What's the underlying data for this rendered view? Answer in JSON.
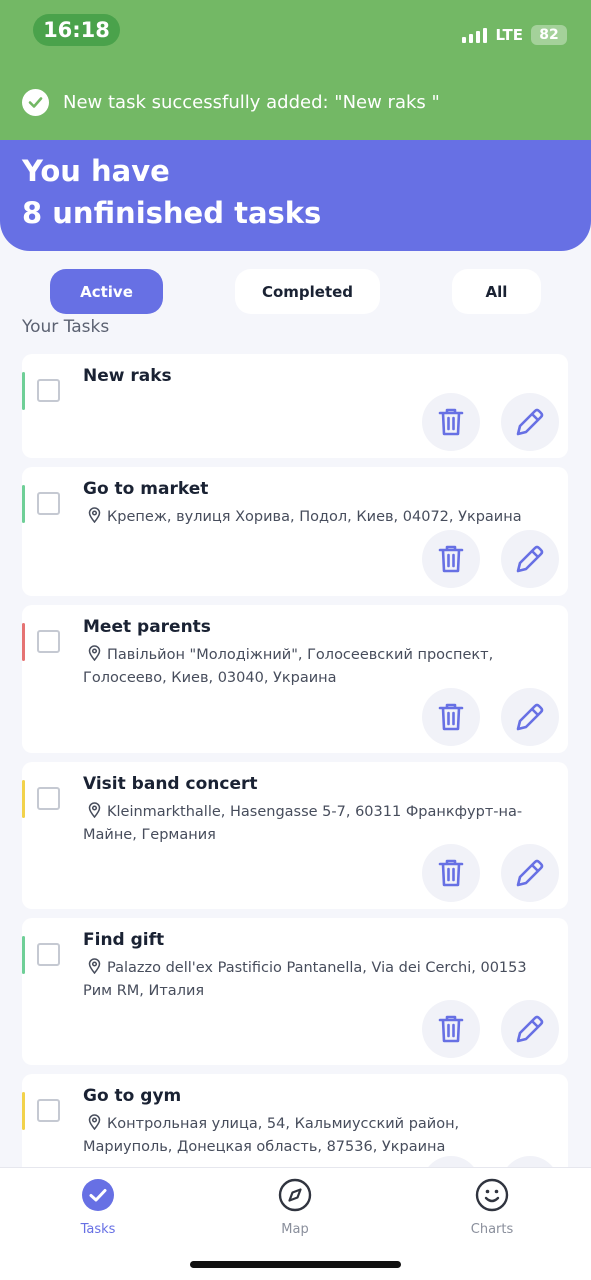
{
  "status_bar": {
    "time": "16:18",
    "network": "LTE",
    "battery": "82"
  },
  "toast": {
    "message": "New task successfully added: \"New raks \"",
    "icon": "check-circle-icon"
  },
  "header": {
    "line1": "You have",
    "line2": "8 unfinished tasks"
  },
  "filters": {
    "active": "Active",
    "completed": "Completed",
    "all": "All",
    "selected": "Active"
  },
  "section_title": "Your Tasks",
  "tasks": [
    {
      "title": "New raks",
      "location": "",
      "priority_color": "#6fcf97"
    },
    {
      "title": "Go to market",
      "location": "Крепеж, вулиця Хорива, Подол, Киев, 04072, Украина",
      "priority_color": "#6fcf97"
    },
    {
      "title": "Meet parents",
      "location": "Павільйон \"Молодіжний\", Голосеевский проспект, Голосеево, Киев, 03040, Украина",
      "priority_color": "#e57373"
    },
    {
      "title": "Visit band concert",
      "location": "Kleinmarkthalle, Hasengasse 5-7, 60311 Франкфурт-на-Майне, Германия",
      "priority_color": "#f2d24b"
    },
    {
      "title": "Find gift",
      "location": "Palazzo dell'ex Pastificio Pantanella, Via dei Cerchi, 00153 Рим RM, Италия",
      "priority_color": "#6fcf97"
    },
    {
      "title": "Go to gym",
      "location": "Контрольная улица, 54, Кальмиусский район, Мариуполь, Донецкая область, 87536, Украина",
      "priority_color": "#f2d24b"
    }
  ],
  "bottom_nav": {
    "tasks": "Tasks",
    "map": "Map",
    "charts": "Charts",
    "active": "Tasks"
  },
  "colors": {
    "accent": "#6770e4",
    "toast_bg": "#73b865",
    "page_bg": "#f5f6fb"
  }
}
